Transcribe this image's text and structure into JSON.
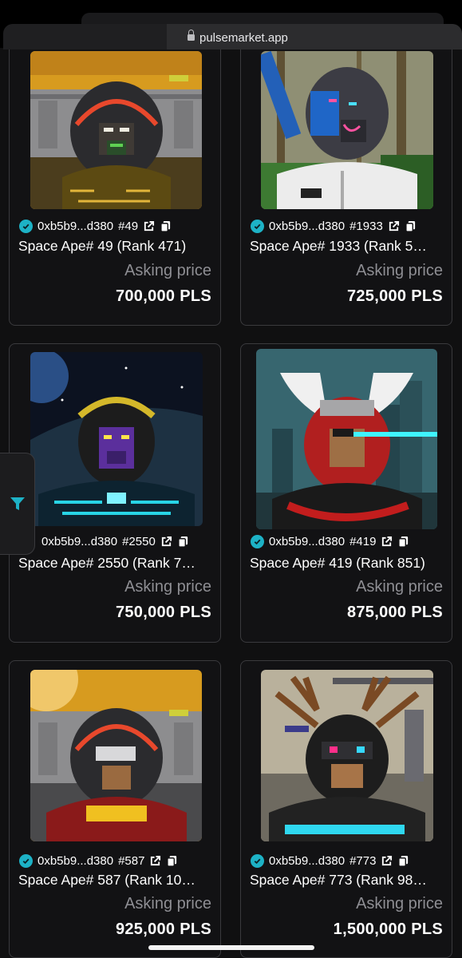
{
  "browser": {
    "url": "pulsemarket.app"
  },
  "filter": {
    "icon": "filter-icon",
    "accent": "#1db2c6"
  },
  "cards": [
    {
      "contract": "0xb5b9...d380",
      "token": "#49",
      "name": "Space Ape# 49 (Rank 471)",
      "ask_label": "Asking price",
      "price": "700,000 PLS"
    },
    {
      "contract": "0xb5b9...d380",
      "token": "#1933",
      "name": "Space Ape# 1933 (Rank 5…",
      "ask_label": "Asking price",
      "price": "725,000 PLS"
    },
    {
      "contract": "0xb5b9...d380",
      "token": "#2550",
      "name": "Space Ape# 2550 (Rank 7…",
      "ask_label": "Asking price",
      "price": "750,000 PLS"
    },
    {
      "contract": "0xb5b9...d380",
      "token": "#419",
      "name": "Space Ape# 419 (Rank 851)",
      "ask_label": "Asking price",
      "price": "875,000 PLS"
    },
    {
      "contract": "0xb5b9...d380",
      "token": "#587",
      "name": "Space Ape# 587 (Rank 10…",
      "ask_label": "Asking price",
      "price": "925,000 PLS"
    },
    {
      "contract": "0xb5b9...d380",
      "token": "#773",
      "name": "Space Ape# 773 (Rank 98…",
      "ask_label": "Asking price",
      "price": "1,500,000 PLS"
    }
  ]
}
